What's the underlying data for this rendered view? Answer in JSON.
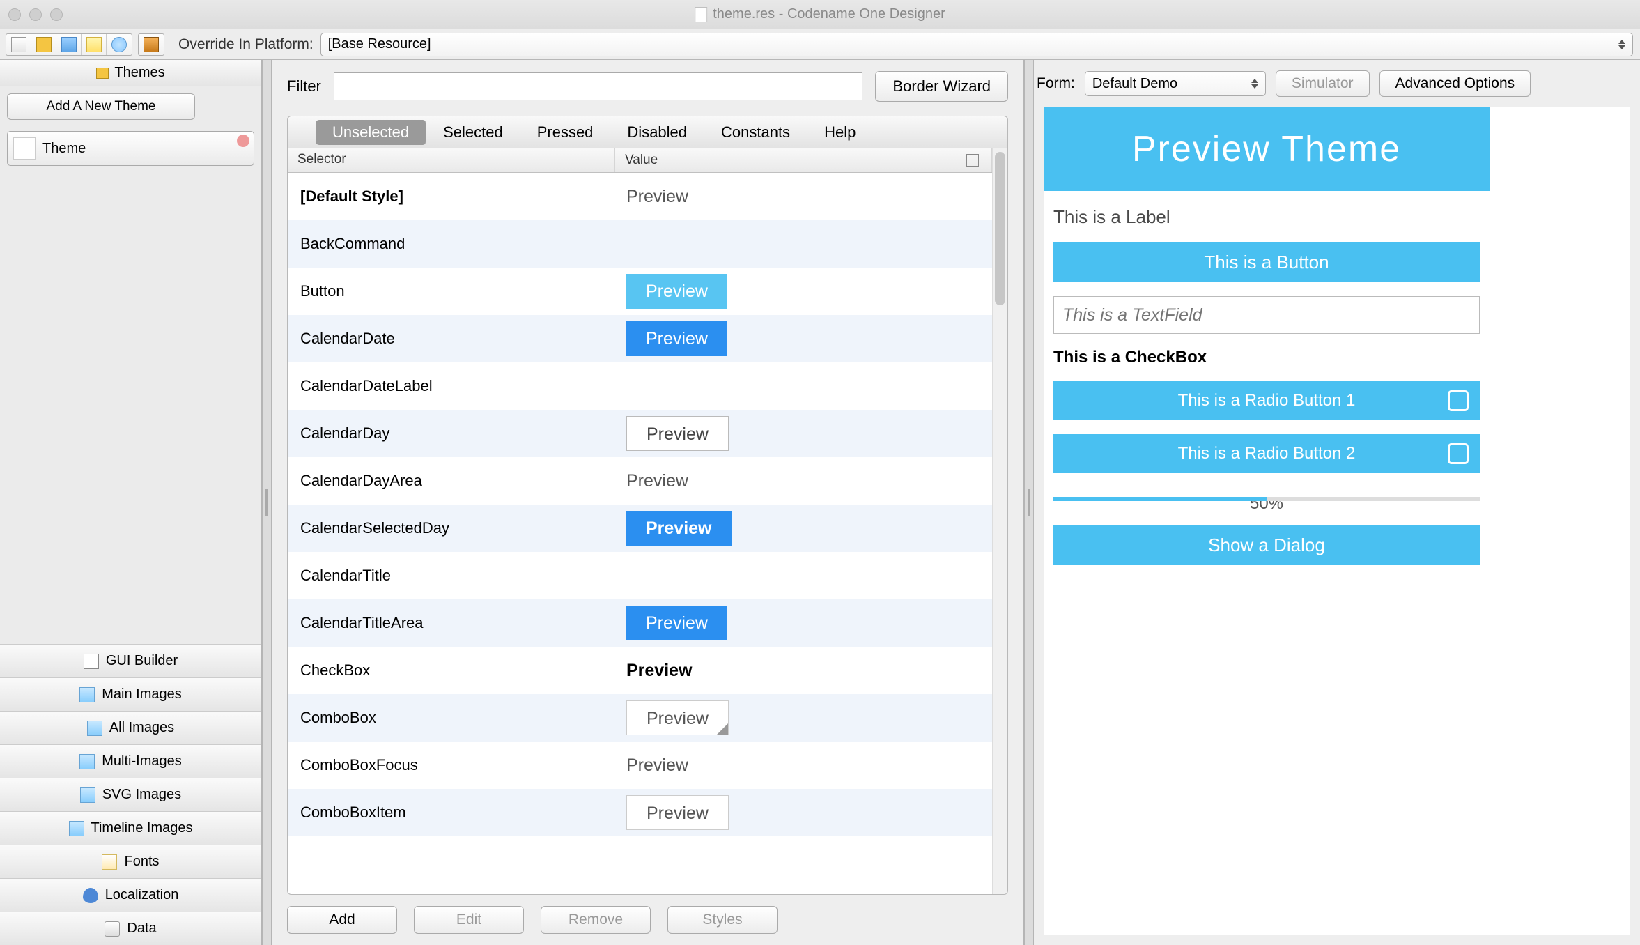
{
  "window": {
    "title": "theme.res - Codename One Designer"
  },
  "toolbar": {
    "override_label": "Override In Platform:",
    "override_value": "[Base Resource]"
  },
  "sidebar": {
    "themes_header": "Themes",
    "add_theme": "Add A New Theme",
    "theme_item": "Theme",
    "sections": {
      "gui_builder": "GUI Builder",
      "main_images": "Main Images",
      "all_images": "All Images",
      "multi_images": "Multi-Images",
      "svg_images": "SVG Images",
      "timeline_images": "Timeline Images",
      "fonts": "Fonts",
      "localization": "Localization",
      "data": "Data"
    }
  },
  "center": {
    "filter_label": "Filter",
    "border_wizard": "Border Wizard",
    "tabs": {
      "unselected": "Unselected",
      "selected": "Selected",
      "pressed": "Pressed",
      "disabled": "Disabled",
      "constants": "Constants",
      "help": "Help"
    },
    "columns": {
      "selector": "Selector",
      "value": "Value"
    },
    "rows": [
      {
        "selector": "[Default Style]",
        "valtext": "Preview",
        "style": "plain",
        "bold": true,
        "alt": false
      },
      {
        "selector": "BackCommand",
        "valtext": "",
        "style": "none",
        "alt": true
      },
      {
        "selector": "Button",
        "valtext": "Preview",
        "style": "lightblue",
        "alt": false
      },
      {
        "selector": "CalendarDate",
        "valtext": "Preview",
        "style": "blue",
        "alt": true
      },
      {
        "selector": "CalendarDateLabel",
        "valtext": "",
        "style": "none",
        "alt": false
      },
      {
        "selector": "CalendarDay",
        "valtext": "Preview",
        "style": "whitebox",
        "alt": true
      },
      {
        "selector": "CalendarDayArea",
        "valtext": "Preview",
        "style": "plain",
        "alt": false
      },
      {
        "selector": "CalendarSelectedDay",
        "valtext": "Preview",
        "style": "bluebold",
        "alt": true
      },
      {
        "selector": "CalendarTitle",
        "valtext": "",
        "style": "none",
        "alt": false
      },
      {
        "selector": "CalendarTitleArea",
        "valtext": "Preview",
        "style": "blue",
        "alt": true
      },
      {
        "selector": "CheckBox",
        "valtext": "Preview",
        "style": "plainbold",
        "alt": false
      },
      {
        "selector": "ComboBox",
        "valtext": "Preview",
        "style": "combobox",
        "alt": true
      },
      {
        "selector": "ComboBoxFocus",
        "valtext": "Preview",
        "style": "plain",
        "alt": false
      },
      {
        "selector": "ComboBoxItem",
        "valtext": "Preview",
        "style": "plainbox",
        "alt": true
      }
    ],
    "buttons": {
      "add": "Add",
      "edit": "Edit",
      "remove": "Remove",
      "styles": "Styles"
    }
  },
  "right": {
    "form_label": "Form:",
    "form_value": "Default Demo",
    "simulator": "Simulator",
    "advanced": "Advanced Options",
    "preview": {
      "header": "Preview Theme",
      "label": "This is a Label",
      "button": "This is a Button",
      "textfield_placeholder": "This is a TextField",
      "checkbox": "This is a CheckBox",
      "radio1": "This is a Radio Button 1",
      "radio2": "This is a Radio Button 2",
      "slider": "50%",
      "dialog": "Show a Dialog"
    }
  }
}
